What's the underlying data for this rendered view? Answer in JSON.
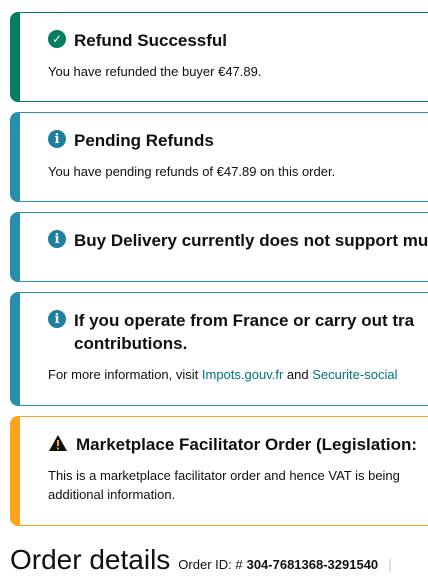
{
  "alerts": {
    "refund_success": {
      "title": "Refund Successful",
      "body": "You have refunded the buyer €47.89."
    },
    "pending_refunds": {
      "title": "Pending Refunds",
      "body": "You have pending refunds of €47.89 on this order."
    },
    "buy_delivery": {
      "title": "Buy Delivery currently does not support mu"
    },
    "france": {
      "title": "If you operate from France or carry out tra",
      "title_line2": "contributions.",
      "body_prefix": "For more information, visit ",
      "link1": "Impots.gouv.fr",
      "body_mid": " and ",
      "link2": "Securite-social"
    },
    "marketplace": {
      "title": "Marketplace Facilitator Order (Legislation:",
      "body": "This is a marketplace facilitator order and hence VAT is being",
      "body_line2": "additional information."
    }
  },
  "order": {
    "heading": "Order details",
    "id_label": "Order ID: #",
    "id_value": "304-7681368-3291540",
    "separator": "|"
  },
  "colors": {
    "success": "#067d62",
    "info": "#2a8fae",
    "warning": "#ffa41c",
    "link": "#007185"
  },
  "icons": {
    "success": "check-circle-icon",
    "info": "info-circle-icon",
    "warning": "warning-triangle-icon"
  }
}
